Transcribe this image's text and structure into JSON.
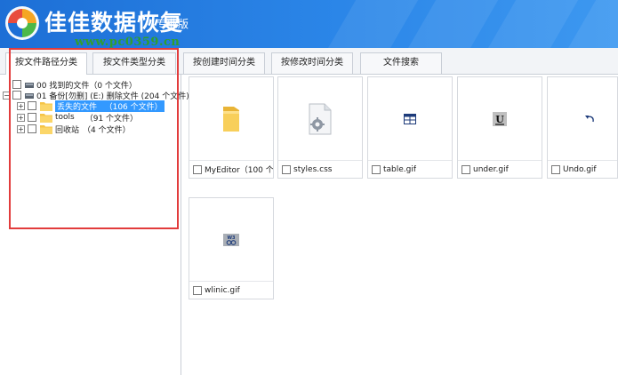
{
  "app": {
    "title": "佳佳数据恢复",
    "edition": "专业版",
    "watermark": "www.pc0359.cn"
  },
  "tabs": [
    {
      "label": "按文件路径分类",
      "active": true
    },
    {
      "label": "按文件类型分类",
      "active": false
    },
    {
      "label": "按创建时间分类",
      "active": false
    },
    {
      "label": "按修改时间分类",
      "active": false
    },
    {
      "label": "文件搜索",
      "active": false
    }
  ],
  "tree": {
    "roots": [
      {
        "label": "00 找到的文件（0 个文件）"
      },
      {
        "label": "01 备份[勿删] (E:) 删除文件 (204 个文件)"
      }
    ],
    "children": [
      {
        "label": "丢失的文件",
        "count": "（106 个文件）",
        "selected": true
      },
      {
        "label": "tools",
        "count": "（91 个文件）",
        "selected": false
      },
      {
        "label": "回收站",
        "count": "（4 个文件）",
        "selected": false
      }
    ]
  },
  "files": [
    {
      "name": "MyEditor（100 个...",
      "icon": "folder-icon"
    },
    {
      "name": "styles.css",
      "icon": "css-file-icon"
    },
    {
      "name": "table.gif",
      "icon": "table-image-icon"
    },
    {
      "name": "under.gif",
      "icon": "underline-image-icon"
    },
    {
      "name": "Undo.gif",
      "icon": "undo-image-icon"
    },
    {
      "name": "wlinic.gif",
      "icon": "link-image-icon"
    }
  ],
  "colors": {
    "header": "#2b86e8",
    "selection": "#3399ff",
    "highlight_box": "#e23c3c",
    "folder": "#f6c445",
    "watermark": "#2f9e2f"
  }
}
